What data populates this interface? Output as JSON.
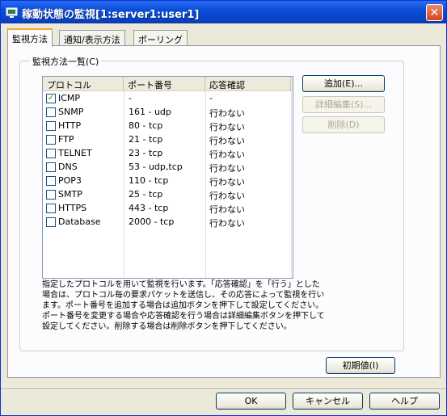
{
  "window": {
    "title": "稼動状態の監視[1:server1:user1]"
  },
  "tabs": [
    {
      "label": "監視方法",
      "active": true
    },
    {
      "label": "通知/表示方法",
      "active": false
    },
    {
      "label": "ポーリング",
      "active": false
    }
  ],
  "group": {
    "label": "監視方法一覧(C)"
  },
  "list": {
    "columns": [
      "プロトコル",
      "ポート番号",
      "応答確認"
    ],
    "rows": [
      {
        "checked": true,
        "protocol": "ICMP",
        "port": "-",
        "response": "-"
      },
      {
        "checked": false,
        "protocol": "SNMP",
        "port": "161 - udp",
        "response": "行わない"
      },
      {
        "checked": false,
        "protocol": "HTTP",
        "port": "80 - tcp",
        "response": "行わない"
      },
      {
        "checked": false,
        "protocol": "FTP",
        "port": "21 - tcp",
        "response": "行わない"
      },
      {
        "checked": false,
        "protocol": "TELNET",
        "port": "23 - tcp",
        "response": "行わない"
      },
      {
        "checked": false,
        "protocol": "DNS",
        "port": "53 - udp,tcp",
        "response": "行わない"
      },
      {
        "checked": false,
        "protocol": "POP3",
        "port": "110 - tcp",
        "response": "行わない"
      },
      {
        "checked": false,
        "protocol": "SMTP",
        "port": "25 - tcp",
        "response": "行わない"
      },
      {
        "checked": false,
        "protocol": "HTTPS",
        "port": "443 - tcp",
        "response": "行わない"
      },
      {
        "checked": false,
        "protocol": "Database",
        "port": "2000 - tcp",
        "response": "行わない"
      }
    ]
  },
  "side_buttons": {
    "add": "追加(E)...",
    "edit": "詳細編集(S)...",
    "delete": "削除(D)"
  },
  "description": "指定したプロトコルを用いて監視を行います。「応答確認」を「行う」とした場合は、プロトコル毎の要求パケットを送信し、その応答によって監視を行います。ポート番号を追加する場合は追加ボタンを押下して設定してください。ポート番号を変更する場合や応答確認を行う場合は詳細編集ボタンを押下して設定してください。削除する場合は削除ボタンを押下してください。",
  "reset_button": "初期値(I)",
  "footer": {
    "ok": "OK",
    "cancel": "キャンセル",
    "help": "ヘルプ"
  }
}
